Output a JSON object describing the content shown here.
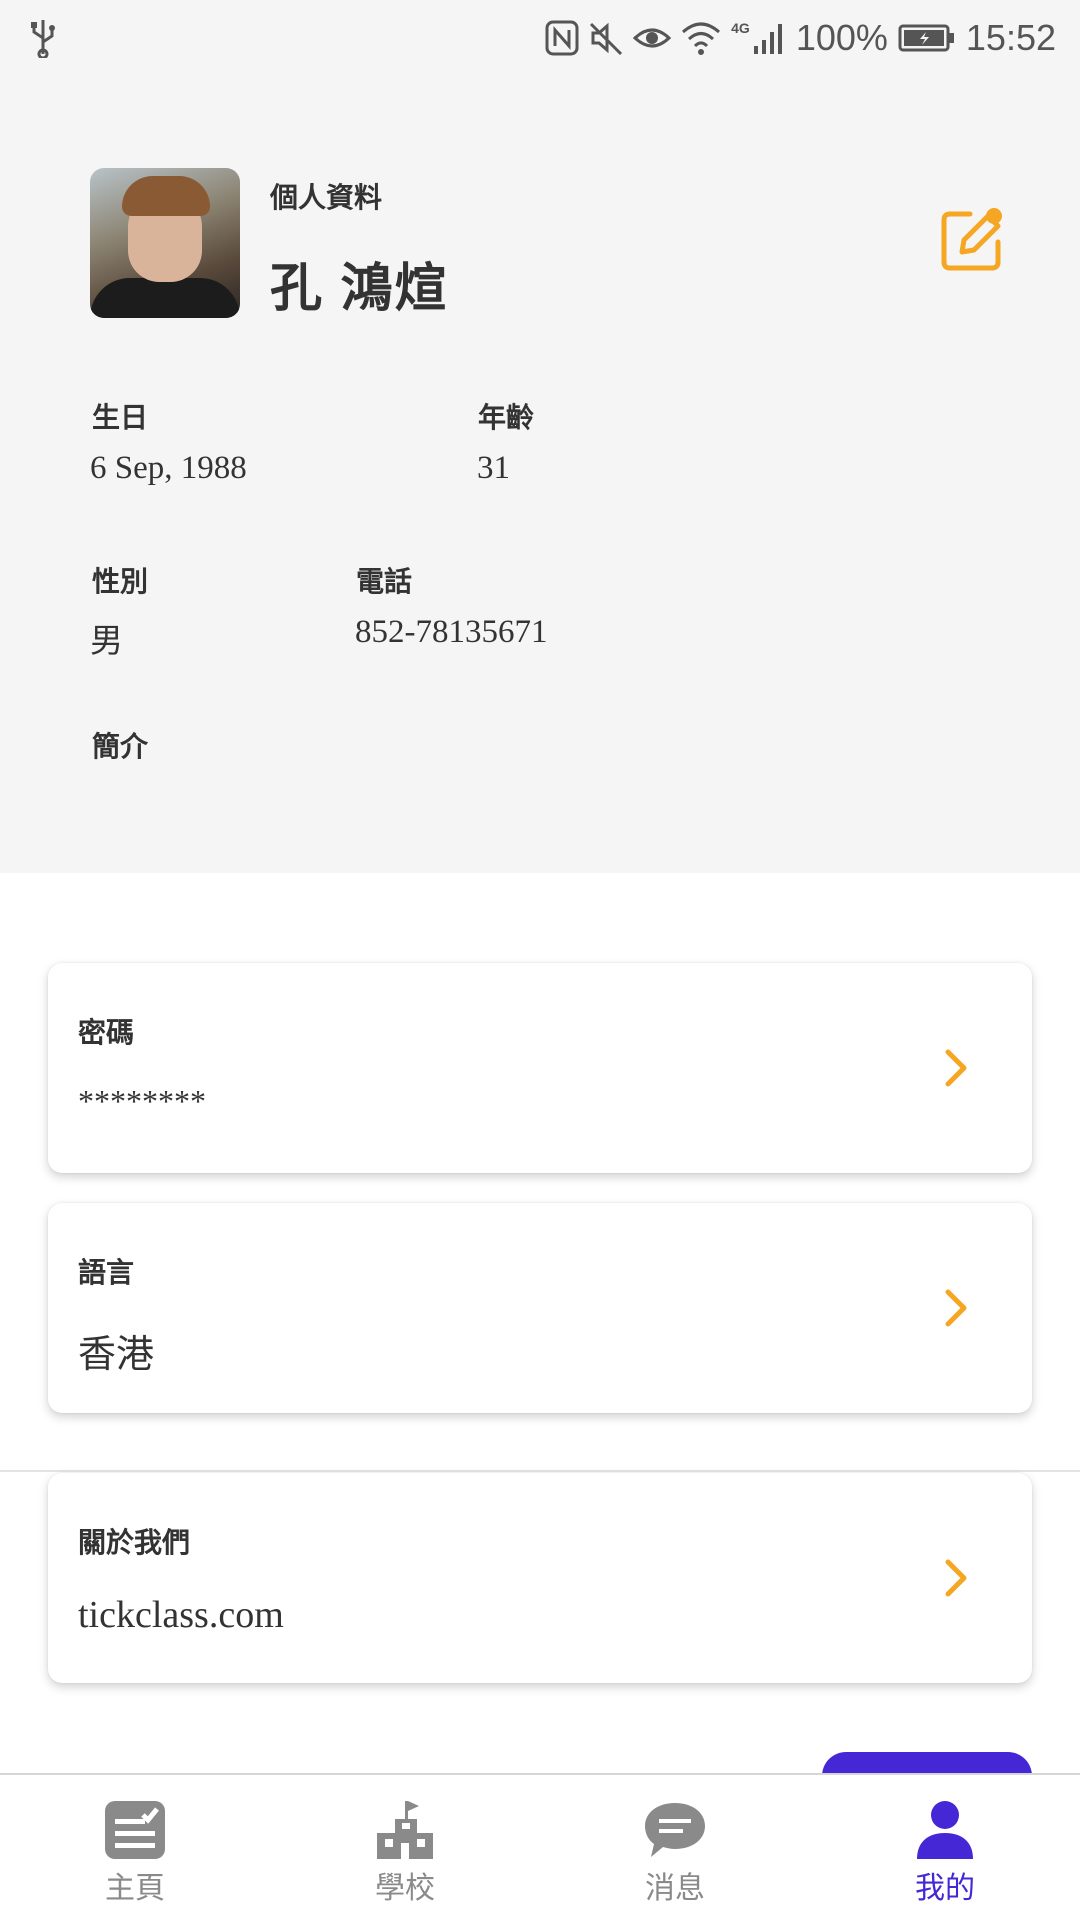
{
  "status_bar": {
    "battery": "100%",
    "time": "15:52",
    "network": "4G",
    "icons": [
      "usb-icon",
      "nfc-icon",
      "mute-icon",
      "eye-icon",
      "wifi-icon",
      "signal-icon",
      "battery-icon"
    ]
  },
  "profile": {
    "section_label": "個人資料",
    "name": "孔 鴻煊",
    "fields": {
      "birthday_label": "生日",
      "birthday_value": "6 Sep, 1988",
      "age_label": "年齡",
      "age_value": "31",
      "gender_label": "性別",
      "gender_value": "男",
      "phone_label": "電話",
      "phone_value": "852-78135671",
      "intro_label": "簡介"
    }
  },
  "settings": [
    {
      "label": "密碼",
      "value": "********"
    },
    {
      "label": "語言",
      "value": "香港"
    },
    {
      "label": "關於我們",
      "value": "tickclass.com"
    }
  ],
  "bottom_nav": {
    "items": [
      {
        "label": "主頁",
        "icon": "home-icon"
      },
      {
        "label": "學校",
        "icon": "school-icon"
      },
      {
        "label": "消息",
        "icon": "message-icon"
      },
      {
        "label": "我的",
        "icon": "profile-icon"
      }
    ]
  },
  "colors": {
    "accent_orange": "#f5a623",
    "accent_purple": "#4527d6",
    "panel_bg": "#f5f5f5"
  }
}
